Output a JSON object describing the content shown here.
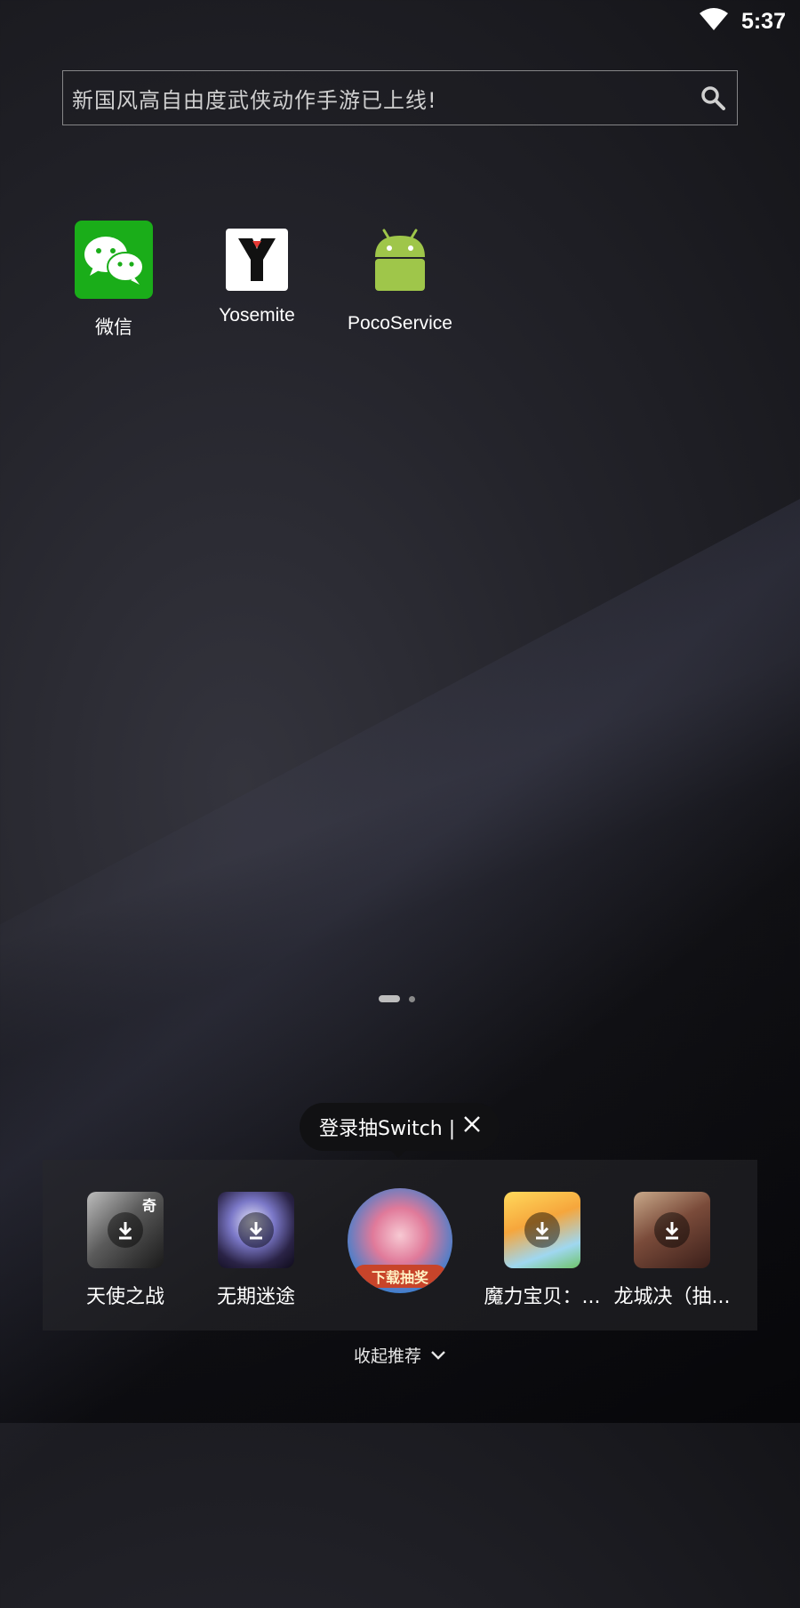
{
  "status_bar": {
    "time": "5:37",
    "wifi_icon": "wifi-icon"
  },
  "search": {
    "text": "新国风高自由度武侠动作手游已上线!",
    "icon": "search-icon"
  },
  "apps": [
    {
      "label": "微信",
      "icon": "wechat-icon",
      "color": "#1AAD19"
    },
    {
      "label": "Yosemite",
      "icon": "yosemite-icon",
      "color": "#FFFFFF"
    },
    {
      "label": "PocoService",
      "icon": "android-icon",
      "color": "#9FC64A"
    }
  ],
  "page_indicator": {
    "pages": 2,
    "current": 1
  },
  "tooltip": {
    "text": "登录抽Switch |",
    "close_icon": "close-icon"
  },
  "recommendations": [
    {
      "label": "天使之战",
      "icon": "download-icon"
    },
    {
      "label": "无期迷途",
      "icon": "download-icon"
    },
    {
      "label": "",
      "badge": "下载抽奖"
    },
    {
      "label": "魔力宝贝：...",
      "icon": "download-icon"
    },
    {
      "label": "龙城决（抽...",
      "icon": "download-icon"
    }
  ],
  "collapse": {
    "text": "收起推荐",
    "icon": "chevron-down-icon"
  }
}
